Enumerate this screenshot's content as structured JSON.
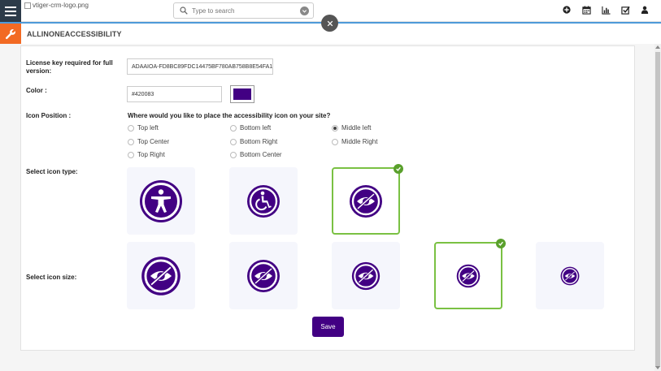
{
  "header": {
    "logo_alt": "vtiger-crm-logo.png",
    "search_placeholder": "Type to search",
    "icons": [
      "plus-circle-icon",
      "calendar-icon",
      "bar-chart-icon",
      "checkbox-icon",
      "user-icon"
    ]
  },
  "module": {
    "title": "ALLINONEACCESSIBILITY"
  },
  "form": {
    "license_label": "License key required for full version:",
    "license_value": "ADAAIOA-FD8BC89FDC14475BF780AB758B8E54FA1",
    "color_label": "Color :",
    "color_value": "#420083",
    "position_label": "Icon Position :",
    "position_question": "Where would you like to place the accessibility icon on your site?",
    "positions": [
      {
        "label": "Top left",
        "selected": false
      },
      {
        "label": "Top Center",
        "selected": false
      },
      {
        "label": "Top Right",
        "selected": false
      },
      {
        "label": "Bottom left",
        "selected": false
      },
      {
        "label": "Bottom Right",
        "selected": false
      },
      {
        "label": "Bottom Center",
        "selected": false
      },
      {
        "label": "Middle left",
        "selected": true
      },
      {
        "label": "Middle Right",
        "selected": false
      }
    ],
    "icon_type_label": "Select icon type:",
    "icon_types": [
      {
        "icon": "accessibility-person-icon",
        "selected": false
      },
      {
        "icon": "wheelchair-icon",
        "selected": false
      },
      {
        "icon": "eye-slash-icon",
        "selected": true
      }
    ],
    "icon_size_label": "Select icon size:",
    "icon_sizes": [
      {
        "icon": "eye-slash-icon",
        "selected": false
      },
      {
        "icon": "eye-slash-icon",
        "selected": false
      },
      {
        "icon": "eye-slash-icon",
        "selected": false
      },
      {
        "icon": "eye-slash-icon",
        "selected": true
      },
      {
        "icon": "eye-slash-icon",
        "selected": false
      }
    ],
    "save_label": "Save"
  },
  "colors": {
    "accent": "#420083",
    "selected_border": "#7ac143",
    "check": "#5aa02c",
    "wrench_bg": "#f26a23",
    "menu_bg": "#2c3b49"
  }
}
